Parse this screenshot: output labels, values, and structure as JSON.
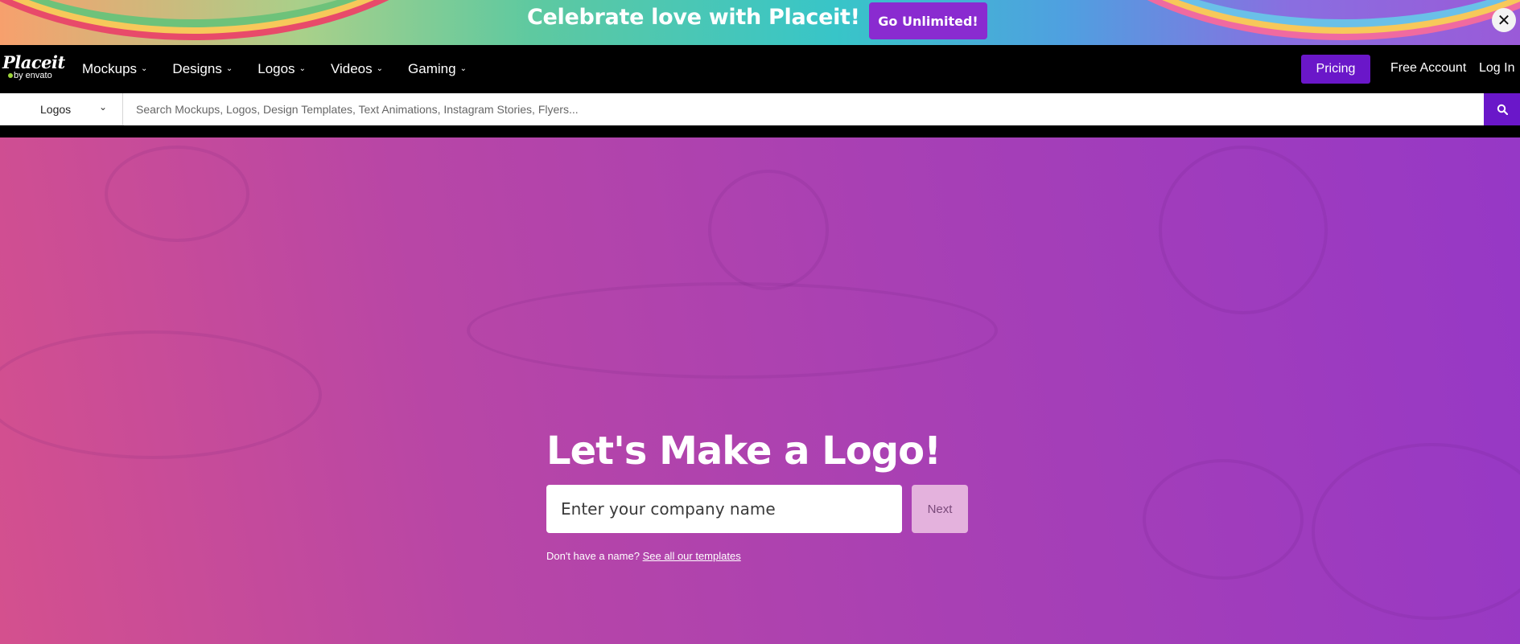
{
  "promo": {
    "text": "Celebrate love with Placeit!",
    "button_label": "Go Unlimited!",
    "close_glyph": "✕"
  },
  "brand": {
    "name": "Placeit",
    "sub": "by envato"
  },
  "nav": {
    "items": [
      {
        "label": "Mockups"
      },
      {
        "label": "Designs"
      },
      {
        "label": "Logos"
      },
      {
        "label": "Videos"
      },
      {
        "label": "Gaming"
      }
    ],
    "pricing_label": "Pricing",
    "free_account_label": "Free Account",
    "login_label": "Log In"
  },
  "search": {
    "category": "Logos",
    "placeholder": "Search Mockups, Logos, Design Templates, Text Animations, Instagram Stories, Flyers..."
  },
  "hero": {
    "title": "Let's Make a Logo!",
    "input_placeholder": "Enter your company name",
    "next_label": "Next",
    "hint_text": "Don't have a name?",
    "hint_link": "See all our templates"
  },
  "colors": {
    "accent": "#6a17c9",
    "promo_button": "#8a2bd0",
    "hero_start": "#d4508e",
    "hero_end": "#9638c6"
  }
}
